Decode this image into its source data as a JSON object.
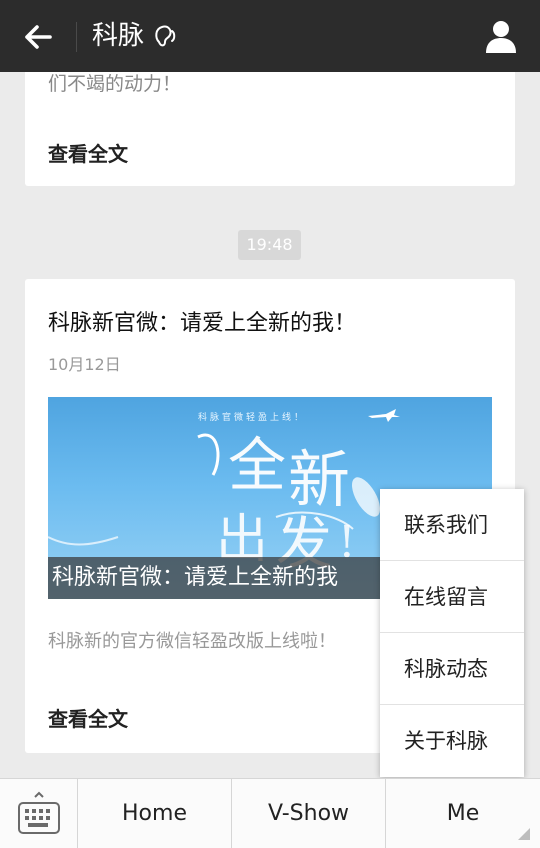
{
  "header": {
    "title": "科脉",
    "back_icon": "arrow-left-icon",
    "profile_icon": "person-icon",
    "colors": {
      "bar": "#2c2c2c",
      "text": "#ffffff"
    }
  },
  "feed": {
    "card1": {
      "truncated_line": "们不竭的动力！",
      "read_more": "查看全文"
    },
    "time_badge": "19:48",
    "card2": {
      "title": "科脉新官微：请爱上全新的我！",
      "date": "10月12日",
      "cover": {
        "top_text": "科脉官微轻盈上线！",
        "art_chars": [
          "全",
          "新",
          "出",
          "发",
          "!"
        ],
        "caption": "科脉新官微：请爱上全新的我"
      },
      "summary": "科脉新的官方微信轻盈改版上线啦！",
      "read_more": "查看全文"
    }
  },
  "popup_menu": {
    "items": [
      "联系我们",
      "在线留言",
      "科脉动态",
      "关于科脉"
    ]
  },
  "bottom_bar": {
    "keyboard_icon": "keyboard-icon",
    "tabs": [
      "Home",
      "V-Show",
      "Me"
    ]
  }
}
